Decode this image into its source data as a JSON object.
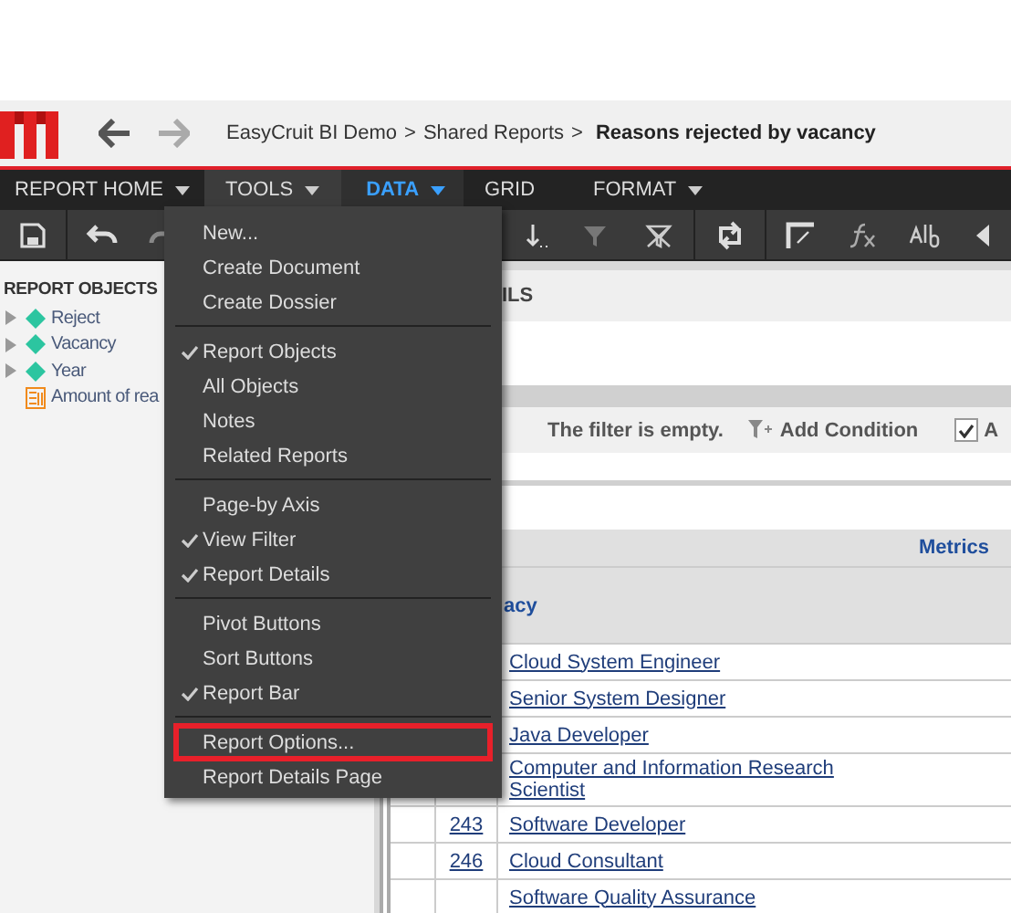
{
  "breadcrumb": {
    "items": [
      "EasyCruit BI Demo",
      "Shared Reports"
    ],
    "separator": ">",
    "current": "Reasons rejected by vacancy"
  },
  "menu_bar": [
    {
      "label": "REPORT HOME",
      "caret": true,
      "open": false,
      "active": false
    },
    {
      "label": "TOOLS",
      "caret": true,
      "open": true,
      "active": false
    },
    {
      "label": "DATA",
      "caret": true,
      "open": false,
      "active": true
    },
    {
      "label": "GRID",
      "caret": false,
      "open": false,
      "active": false
    },
    {
      "label": "FORMAT",
      "caret": true,
      "open": false,
      "active": false
    }
  ],
  "tools_menu": {
    "sections": [
      [
        {
          "label": "New...",
          "checked": false,
          "highlighted": false
        },
        {
          "label": "Create Document",
          "checked": false,
          "highlighted": false
        },
        {
          "label": "Create Dossier",
          "checked": false,
          "highlighted": false
        }
      ],
      [
        {
          "label": "Report Objects",
          "checked": true,
          "highlighted": false
        },
        {
          "label": "All Objects",
          "checked": false,
          "highlighted": false
        },
        {
          "label": "Notes",
          "checked": false,
          "highlighted": false
        },
        {
          "label": "Related Reports",
          "checked": false,
          "highlighted": false
        }
      ],
      [
        {
          "label": "Page-by Axis",
          "checked": false,
          "highlighted": false
        },
        {
          "label": "View Filter",
          "checked": true,
          "highlighted": false
        },
        {
          "label": "Report Details",
          "checked": true,
          "highlighted": false
        }
      ],
      [
        {
          "label": "Pivot Buttons",
          "checked": false,
          "highlighted": false
        },
        {
          "label": "Sort Buttons",
          "checked": false,
          "highlighted": false
        },
        {
          "label": "Report Bar",
          "checked": true,
          "highlighted": false
        }
      ],
      [
        {
          "label": "Report Options...",
          "checked": false,
          "highlighted": true
        },
        {
          "label": "Report Details Page",
          "checked": false,
          "highlighted": false
        }
      ]
    ]
  },
  "sidebar": {
    "title": "REPORT OBJECTS",
    "items": [
      {
        "label": "Reject",
        "kind": "attribute",
        "expandable": true
      },
      {
        "label": "Vacancy",
        "kind": "attribute",
        "expandable": true
      },
      {
        "label": "Year",
        "kind": "attribute",
        "expandable": true
      },
      {
        "label": "Amount of rea",
        "kind": "metric",
        "expandable": false
      }
    ]
  },
  "details_panel": {
    "title": "ILS"
  },
  "filter_panel": {
    "message": "The filter is empty.",
    "add_condition": "Add Condition",
    "option": {
      "label": "A",
      "checked": true
    }
  },
  "grid": {
    "metrics_header": "Metrics",
    "row_header": "acy",
    "rows": [
      {
        "id": "",
        "name": "Cloud System Engineer"
      },
      {
        "id": "",
        "name": "Senior System Designer"
      },
      {
        "id": "",
        "name": "Java Developer"
      },
      {
        "id": "",
        "name": "Computer and Information Research Scientist"
      },
      {
        "id": "243",
        "name": "Software Developer"
      },
      {
        "id": "246",
        "name": "Cloud Consultant"
      },
      {
        "id": "",
        "name": "Software Quality Assurance"
      }
    ]
  }
}
